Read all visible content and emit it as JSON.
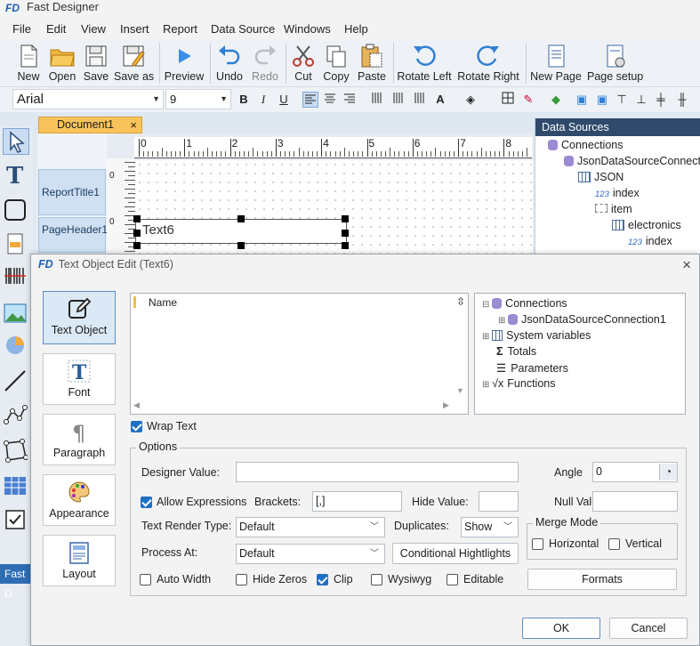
{
  "app": {
    "logo": "FD",
    "title": "Fast Designer"
  },
  "menu": [
    "File",
    "Edit",
    "View",
    "Insert",
    "Report",
    "Data Source",
    "Windows",
    "Help"
  ],
  "toolbar": {
    "new": "New",
    "open": "Open",
    "save": "Save",
    "save_as": "Save as",
    "preview": "Preview",
    "undo": "Undo",
    "redo": "Redo",
    "cut": "Cut",
    "copy": "Copy",
    "paste": "Paste",
    "rotate_left": "Rotate Left",
    "rotate_right": "Rotate Right",
    "new_page": "New Page",
    "page_setup": "Page setup"
  },
  "format": {
    "font": "Arial",
    "size": "9",
    "bold": "B",
    "italic": "I",
    "underline": "U"
  },
  "document": {
    "tab": "Document1",
    "close": "×"
  },
  "bands": {
    "report_title": "ReportTitle1",
    "page_header": "PageHeader1",
    "zero": "0"
  },
  "ruler": [
    "0",
    "1",
    "2",
    "3",
    "4",
    "5",
    "6",
    "7",
    "8"
  ],
  "canvas": {
    "text_object": "Text6"
  },
  "data_sources": {
    "header": "Data Sources",
    "items": [
      "Connections",
      "JsonDataSourceConnection",
      "JSON",
      "index",
      "item",
      "electronics",
      "index"
    ],
    "num_tag": "123"
  },
  "status": {
    "fast_d": "Fast D"
  },
  "dialog": {
    "logo": "FD",
    "title": "Text Object Edit (Text6)",
    "close": "×",
    "sidebar": [
      "Text Object",
      "Font",
      "Paragraph",
      "Appearance",
      "Layout"
    ],
    "name_header": "Name",
    "tree": [
      "Connections",
      "JsonDataSourceConnection1",
      "System variables",
      "Totals",
      "Parameters",
      "Functions"
    ],
    "wrap_text": "Wrap Text",
    "options": "Options",
    "designer_value": "Designer Value:",
    "angle": "Angle",
    "angle_value": "0",
    "allow_expressions": "Allow Expressions",
    "brackets": "Brackets:",
    "brackets_value": "[,]",
    "hide_value": "Hide Value:",
    "null_value": "Null Value:",
    "text_render_type": "Text Render Type:",
    "text_render_value": "Default",
    "duplicates": "Duplicates:",
    "duplicates_value": "Show",
    "merge_mode": "Merge Mode",
    "horizontal": "Horizontal",
    "vertical": "Vertical",
    "process_at": "Process At:",
    "process_at_value": "Default",
    "conditional": "Conditional Hightlights",
    "auto_width": "Auto Width",
    "hide_zeros": "Hide Zeros",
    "clip": "Clip",
    "wysiwyg": "Wysiwyg",
    "editable": "Editable",
    "formats": "Formats",
    "ok": "OK",
    "cancel": "Cancel"
  },
  "colors": {
    "accent": "#1f6fc4",
    "tab": "#f9c35c",
    "panel_header": "#2f4a6b"
  }
}
